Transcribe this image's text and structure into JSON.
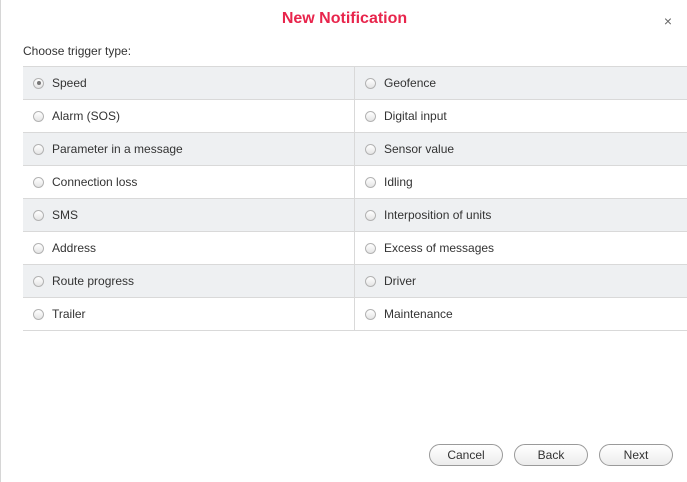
{
  "dialog": {
    "title": "New Notification",
    "close_glyph": "×",
    "subtitle": "Choose trigger type:"
  },
  "trigger_types": [
    {
      "left": "Speed",
      "right": "Geofence",
      "left_checked": true,
      "right_checked": false
    },
    {
      "left": "Alarm (SOS)",
      "right": "Digital input",
      "left_checked": false,
      "right_checked": false
    },
    {
      "left": "Parameter in a message",
      "right": "Sensor value",
      "left_checked": false,
      "right_checked": false
    },
    {
      "left": "Connection loss",
      "right": "Idling",
      "left_checked": false,
      "right_checked": false
    },
    {
      "left": "SMS",
      "right": "Interposition of units",
      "left_checked": false,
      "right_checked": false
    },
    {
      "left": "Address",
      "right": "Excess of messages",
      "left_checked": false,
      "right_checked": false
    },
    {
      "left": "Route progress",
      "right": "Driver",
      "left_checked": false,
      "right_checked": false
    },
    {
      "left": "Trailer",
      "right": "Maintenance",
      "left_checked": false,
      "right_checked": false
    }
  ],
  "buttons": {
    "cancel": "Cancel",
    "back": "Back",
    "next": "Next"
  },
  "colors": {
    "title": "#e8254c",
    "row_shaded": "#eef0f2",
    "border": "#d9d9d9"
  }
}
